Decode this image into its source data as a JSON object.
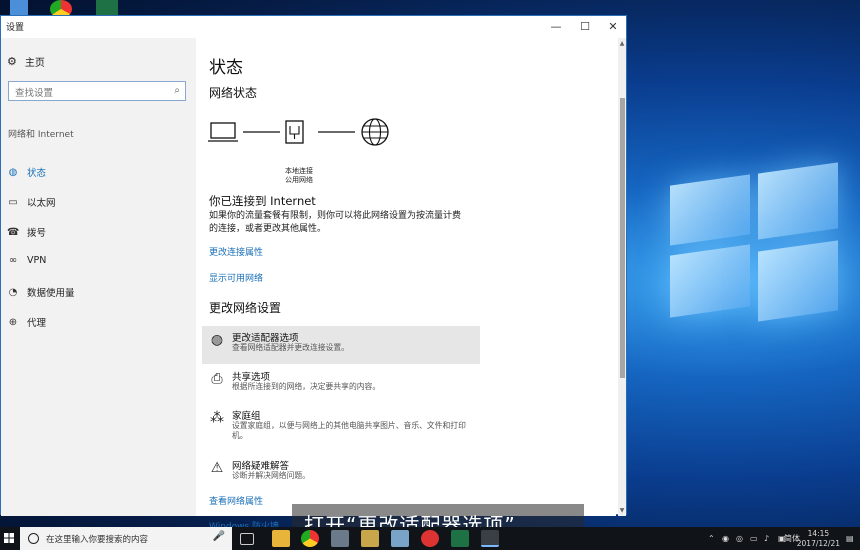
{
  "window": {
    "title": "设置",
    "minimize": "—",
    "maximize": "☐",
    "close": "✕"
  },
  "nav": {
    "home": "主页",
    "search_placeholder": "查找设置",
    "section": "网络和 Internet",
    "items": [
      {
        "label": "状态",
        "icon": "globe-icon",
        "active": true
      },
      {
        "label": "以太网",
        "icon": "monitor-icon",
        "active": false
      },
      {
        "label": "拨号",
        "icon": "dialup-icon",
        "active": false
      },
      {
        "label": "VPN",
        "icon": "vpn-icon",
        "active": false
      },
      {
        "label": "数据使用量",
        "icon": "pie-icon",
        "active": false
      },
      {
        "label": "代理",
        "icon": "globe-icon",
        "active": false
      }
    ]
  },
  "main": {
    "title": "状态",
    "network_status": "网络状态",
    "diagram_label_1": "本地连接",
    "diagram_label_2": "公用网络",
    "connected": "你已连接到 Internet",
    "description": "如果你的流量套餐有限制，则你可以将此网络设置为按流量计费的连接，或者更改其他属性。",
    "link_change_props": "更改连接属性",
    "link_show_networks": "显示可用网络",
    "change_settings": "更改网络设置",
    "settings": [
      {
        "title": "更改适配器选项",
        "desc": "查看网络适配器并更改连接设置。",
        "icon": "adapter-icon"
      },
      {
        "title": "共享选项",
        "desc": "根据所连接到的网络，决定要共享的内容。",
        "icon": "share-icon"
      },
      {
        "title": "家庭组",
        "desc": "设置家庭组，以便与网络上的其他电脑共享图片、音乐、文件和打印机。",
        "icon": "homegroup-icon"
      },
      {
        "title": "网络疑难解答",
        "desc": "诊断并解决网络问题。",
        "icon": "warning-icon"
      }
    ],
    "link_view_properties": "查看网络属性",
    "link_firewall": "Windows 防火墙"
  },
  "subtitle": "打开“更改适配器选项”",
  "taskbar": {
    "search_placeholder": "在这里输入你要搜索的内容",
    "ime": "简体",
    "time": "14:15",
    "date": "2017/12/21"
  }
}
